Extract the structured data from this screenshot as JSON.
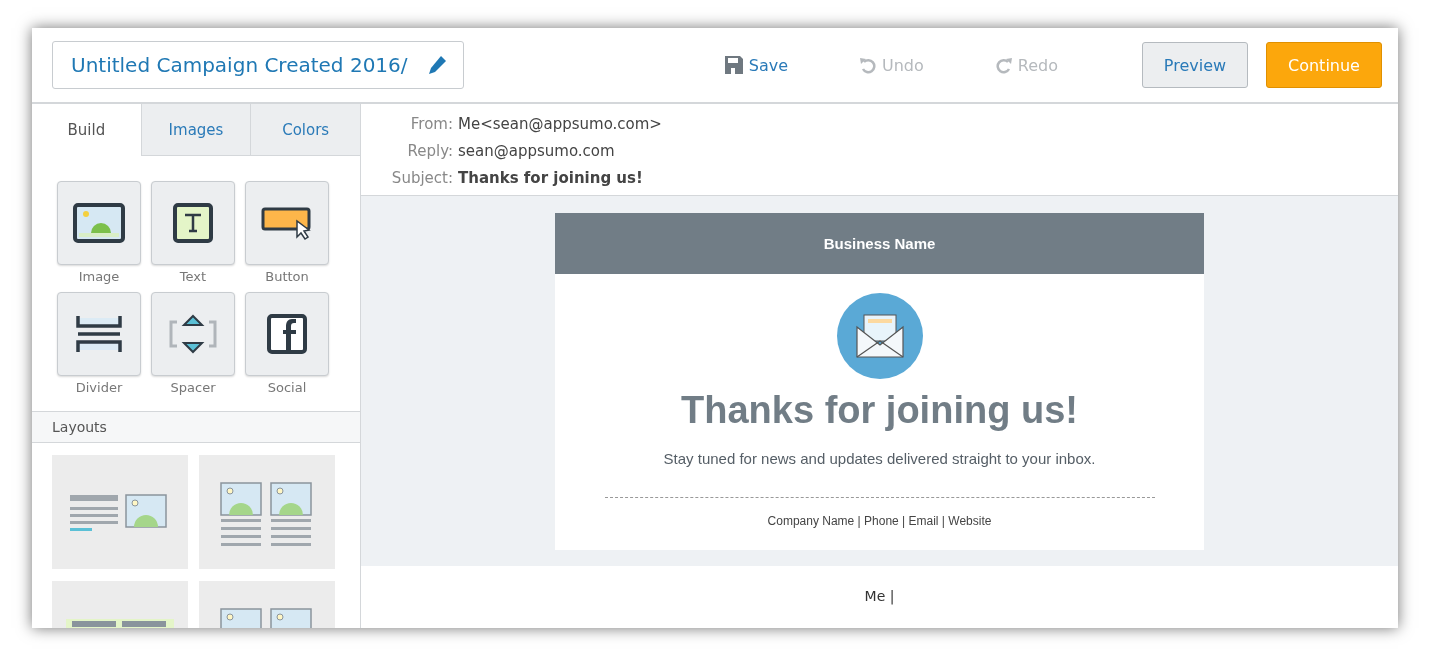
{
  "campaign_title": "Untitled Campaign Created 2016/",
  "toolbar": [
    {
      "kind": "save",
      "label": "Save",
      "disabled": false
    },
    {
      "kind": "undo",
      "label": "Undo",
      "disabled": true
    },
    {
      "kind": "redo",
      "label": "Redo",
      "disabled": true
    }
  ],
  "buttons": [
    {
      "kind": "secondary",
      "label": "Preview"
    },
    {
      "kind": "primary",
      "label": "Continue"
    }
  ],
  "tabs": [
    {
      "label": "Build",
      "selected": true
    },
    {
      "label": "Images",
      "selected": false
    },
    {
      "label": "Colors",
      "selected": false
    }
  ],
  "blocks": [
    {
      "kind": "image",
      "label": "Image"
    },
    {
      "kind": "text",
      "label": "Text"
    },
    {
      "kind": "button",
      "label": "Button"
    },
    {
      "kind": "divider",
      "label": "Divider"
    },
    {
      "kind": "spacer",
      "label": "Spacer"
    },
    {
      "kind": "social",
      "label": "Social"
    }
  ],
  "layouts": {
    "title": "Layouts",
    "items": [
      {
        "kind": "text-image"
      },
      {
        "kind": "two-column"
      },
      {
        "kind": "banner"
      },
      {
        "kind": "two-column"
      }
    ]
  },
  "email_meta": [
    {
      "label": "From:",
      "value": "Me<sean@appsumo.com>",
      "bold": false
    },
    {
      "label": "Reply:",
      "value": "sean@appsumo.com",
      "bold": false
    },
    {
      "label": "Subject:",
      "value": "Thanks for joining us!",
      "bold": true
    }
  ],
  "email": {
    "header": "Business Name",
    "heading": "Thanks for joining us!",
    "body": "Stay tuned for news and updates delivered straight to your inbox.",
    "footer": "Company Name | Phone | Email | Website"
  },
  "signature": "Me |"
}
